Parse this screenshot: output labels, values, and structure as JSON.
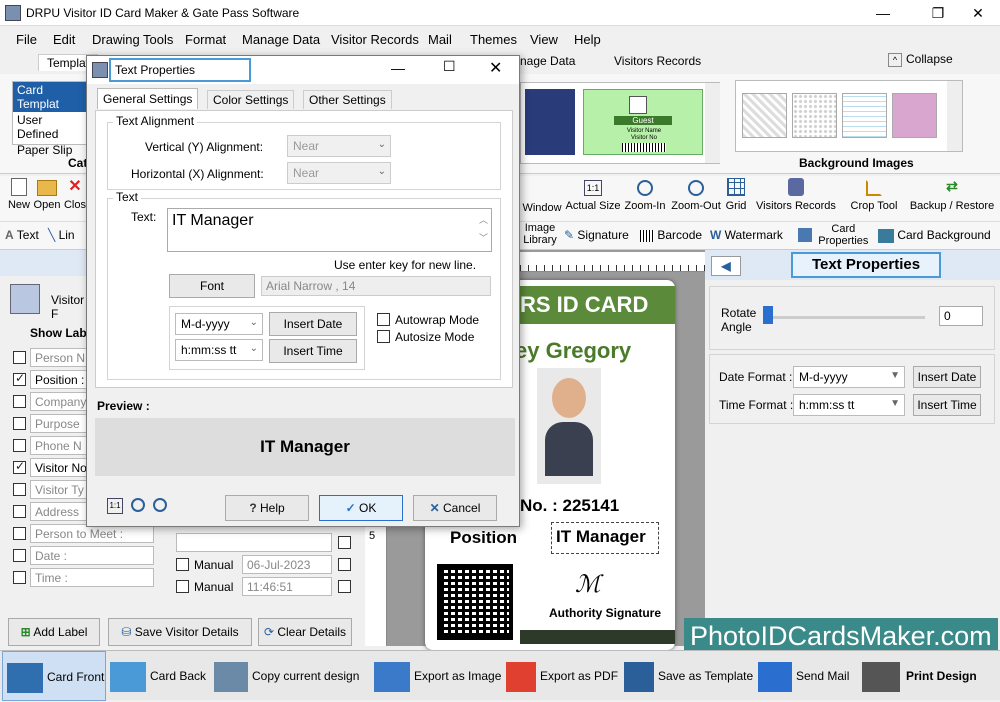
{
  "app": {
    "title": "DRPU Visitor ID Card Maker & Gate Pass Software"
  },
  "menu": [
    "File",
    "Edit",
    "Drawing Tools",
    "Format",
    "Manage Data",
    "Visitor Records",
    "Mail",
    "Themes",
    "View",
    "Help"
  ],
  "ribbon": {
    "tab_templates": "Templat",
    "tab_manage_data": "nage Data",
    "tab_visitors_records": "Visitors Records",
    "collapse": "Collapse",
    "template_list": [
      "Card Templat",
      "User Defined",
      "Paper Slip"
    ],
    "cat_label": "Cat",
    "background_images": "Background Images",
    "guest": "Guest",
    "visitor_name": "Visitor Name",
    "visitor_no": "Visitor No"
  },
  "toolbar": {
    "new": "New",
    "open": "Open",
    "close": "Clos",
    "window": "Window",
    "actual_size": "Actual Size",
    "zoom_in": "Zoom-In",
    "zoom_out": "Zoom-Out",
    "grid": "Grid",
    "visitors_records": "Visitors Records",
    "crop_tool": "Crop Tool",
    "backup": "Backup / Restore"
  },
  "toolbar2": {
    "text": "Text",
    "line": "Lin",
    "image_library": "Image Library",
    "signature": "Signature",
    "barcode": "Barcode",
    "watermark": "Watermark",
    "card_properties": "Card Properties",
    "card_background": "Card Background"
  },
  "left": {
    "visitor_form": "Visitor F",
    "show_label": "Show Labe",
    "fields": [
      {
        "label": "Person N",
        "checked": false
      },
      {
        "label": "Position :",
        "checked": true
      },
      {
        "label": "Company",
        "checked": false
      },
      {
        "label": "Purpose",
        "checked": false
      },
      {
        "label": "Phone N",
        "checked": false
      },
      {
        "label": "Visitor No",
        "checked": true
      },
      {
        "label": "Visitor Ty",
        "checked": false
      },
      {
        "label": "Address",
        "checked": false
      },
      {
        "label": "Person to Meet :",
        "checked": false
      },
      {
        "label": "Date :",
        "checked": false
      },
      {
        "label": "Time :",
        "checked": false
      }
    ],
    "manual": "Manual",
    "date_value": "06-Jul-2023",
    "time_value": "11:46:51",
    "add_label": "Add Label",
    "save_visitor": "Save Visitor Details",
    "clear": "Clear Details"
  },
  "ruler": {
    "five": "5"
  },
  "card": {
    "title": "RS ID CARD",
    "name": "ey Gregory",
    "no": "No. : 225141",
    "position": "Position",
    "position_value": "IT Manager",
    "signature": "Authority Signature"
  },
  "watermark": "PhotoIDCardsMaker.com",
  "right": {
    "header": "Text Properties",
    "rotate": "Rotate Angle",
    "rotate_value": "0",
    "date_format_label": "Date Format :",
    "date_format": "M-d-yyyy",
    "time_format_label": "Time Format :",
    "time_format": "h:mm:ss tt",
    "insert_date": "Insert Date",
    "insert_time": "Insert Time"
  },
  "bottom": {
    "card_front": "Card Front",
    "card_back": "Card Back",
    "copy": "Copy current design",
    "export_image": "Export as Image",
    "export_pdf": "Export as PDF",
    "save_template": "Save as Template",
    "send_mail": "Send Mail",
    "print": "Print Design"
  },
  "dialog": {
    "title": "Text Properties",
    "tabs": [
      "General Settings",
      "Color Settings",
      "Other Settings"
    ],
    "text_alignment": "Text Alignment",
    "vertical": "Vertical (Y) Alignment:",
    "horizontal": "Horizontal (X) Alignment:",
    "near": "Near",
    "text_group": "Text",
    "text_label": "Text:",
    "text_value": "IT Manager",
    "hint": "Use enter key for new line.",
    "font": "Font",
    "font_value": "Arial Narrow , 14",
    "date_fmt": "M-d-yyyy",
    "time_fmt": "h:mm:ss tt",
    "insert_date": "Insert Date",
    "insert_time": "Insert Time",
    "autowrap": "Autowrap Mode",
    "autosize": "Autosize Mode",
    "preview": "Preview :",
    "preview_text": "IT Manager",
    "help": "Help",
    "ok": "OK",
    "cancel": "Cancel"
  },
  "colors": {
    "accent": "#1f5fa8",
    "card_green": "#5a8a3a",
    "card_bar": "#2d6a1f"
  }
}
